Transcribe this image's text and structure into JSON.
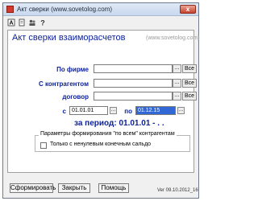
{
  "window": {
    "title": "Акт сверки (www.sovetolog.com)",
    "close_glyph": "x"
  },
  "toolbar": {
    "icons": [
      "report-icon",
      "doc-icon",
      "users-icon",
      "help-icon"
    ]
  },
  "main": {
    "heading": "Акт сверки взаиморасчетов",
    "site": "(www.sovetolog.com)",
    "filters": {
      "firm": {
        "label": "По фирме",
        "value": "",
        "all_label": "Все"
      },
      "counterparty": {
        "label": "С контрагентом",
        "value": "",
        "all_label": "Все"
      },
      "contract": {
        "label": "договор",
        "value": "",
        "all_label": "Все"
      }
    },
    "dates": {
      "from_label": "с",
      "from": "01.01.01",
      "to_label": "по",
      "to": "01.12.15"
    },
    "period_text": "за период: 01.01.01 - . .",
    "group": {
      "title": "Параметры формирования \"по всем\" контрагентам",
      "checkbox_label": "Только с ненулевым конечным сальдо",
      "checked": false
    }
  },
  "footer": {
    "form_label": "Сформировать",
    "close_label": "Закрыть",
    "help_label": "Помощь",
    "version": "Ver 09.10.2012_16"
  }
}
